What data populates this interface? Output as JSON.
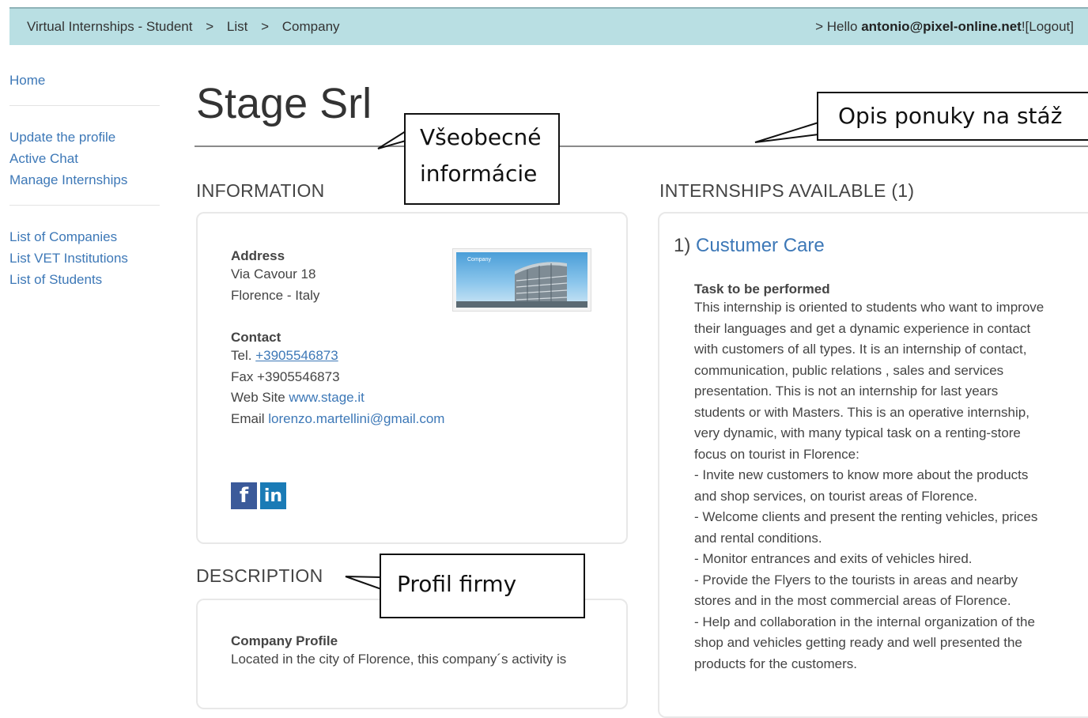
{
  "topbar": {
    "breadcrumbs": [
      "Virtual Internships - Student",
      "List",
      "Company"
    ],
    "separator": ">",
    "greeting_prefix": "> Hello",
    "user_email": "antonio@pixel-online.net",
    "logout_label": "![Logout]"
  },
  "sidebar": {
    "home": "Home",
    "group1": [
      "Update the profile",
      "Active Chat",
      "Manage Internships"
    ],
    "group2": [
      "List of Companies",
      "List VET Institutions",
      "List of Students"
    ]
  },
  "page": {
    "title": "Stage Srl"
  },
  "information": {
    "heading": "INFORMATION",
    "address_label": "Address",
    "address_line1": "Via Cavour 18",
    "address_line2": "Florence - Italy",
    "contact_label": "Contact",
    "tel_prefix": "Tel.",
    "tel_value": "+3905546873",
    "fax_line": "Fax +3905546873",
    "website_prefix": "Web Site",
    "website_value": "www.stage.it",
    "email_prefix": "Email",
    "email_value": "lorenzo.martellini@gmail.com",
    "image_caption": "Company",
    "social_icons": [
      "facebook-icon",
      "linkedin-icon"
    ]
  },
  "description": {
    "heading": "DESCRIPTION",
    "profile_label": "Company Profile",
    "profile_text": "Located in the city of Florence, this company´s activity is"
  },
  "internships": {
    "heading": "INTERNSHIPS AVAILABLE (1)",
    "item_number": "1)",
    "item_title": "Custumer Care",
    "task_label": "Task to be performed",
    "task_lines": [
      "This internship is oriented to students who want to improve",
      "their languages and get a dynamic experience in contact",
      "with customers of all types. It is an internship of contact,",
      "communication, public relations , sales and services",
      "presentation. This is not an internship for last years",
      "students or with Masters. This is an operative internship,",
      "very dynamic, with many typical task on a renting-store",
      "focus on tourist in Florence:",
      "- Invite new customers to know more about the products",
      "and shop services, on tourist areas of Florence.",
      "- Welcome clients and present the renting vehicles, prices",
      "and rental conditions.",
      "- Monitor entrances and exits of vehicles hired.",
      "- Provide the Flyers to the tourists in areas and nearby",
      "stores and in the most commercial areas of Florence.",
      "- Help and collaboration in the internal organization of the",
      "shop and vehicles getting ready and well presented the",
      "products for the customers."
    ]
  },
  "callouts": {
    "general_info_line1": "Všeobecné",
    "general_info_line2": "informácie",
    "offer_description": "Opis ponuky na stáž",
    "company_profile": "Profil firmy"
  },
  "colors": {
    "topbar_bg": "#b9dfe3",
    "link": "#3d78b7",
    "facebook": "#3b5a9a",
    "linkedin": "#1a7bb6"
  }
}
